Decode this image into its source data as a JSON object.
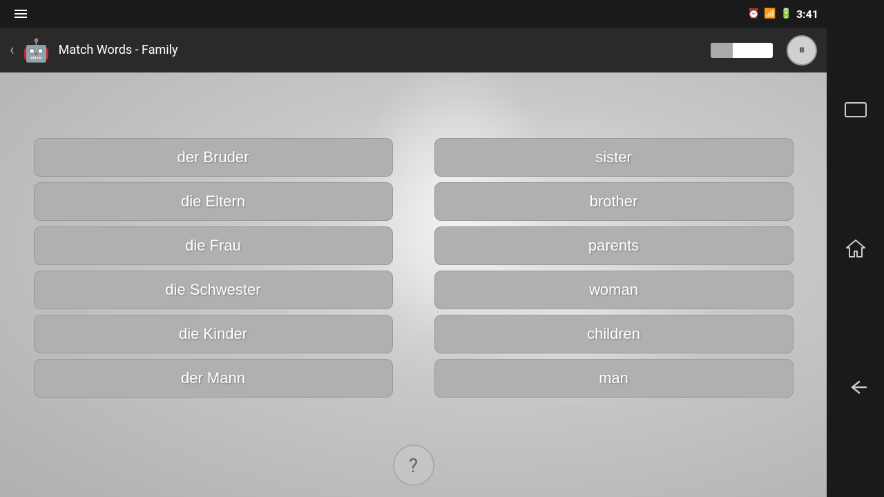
{
  "statusBar": {
    "time": "3:41",
    "icons": [
      "alarm",
      "signal",
      "battery"
    ]
  },
  "topBar": {
    "title": "Match Words - Family",
    "backLabel": "‹",
    "pauseIcon": "⏸",
    "progressPercent": 35
  },
  "leftColumn": {
    "items": [
      {
        "id": "der-bruder",
        "label": "der Bruder"
      },
      {
        "id": "die-eltern",
        "label": "die Eltern"
      },
      {
        "id": "die-frau",
        "label": "die Frau"
      },
      {
        "id": "die-schwester",
        "label": "die Schwester"
      },
      {
        "id": "die-kinder",
        "label": "die Kinder"
      },
      {
        "id": "der-mann",
        "label": "der Mann"
      }
    ]
  },
  "rightColumn": {
    "items": [
      {
        "id": "sister",
        "label": "sister"
      },
      {
        "id": "brother",
        "label": "brother"
      },
      {
        "id": "parents",
        "label": "parents"
      },
      {
        "id": "woman",
        "label": "woman"
      },
      {
        "id": "children",
        "label": "children"
      },
      {
        "id": "man",
        "label": "man"
      }
    ]
  },
  "helpBtn": {
    "label": "?"
  },
  "sideNav": {
    "icons": [
      "⬜",
      "⌂",
      "↩"
    ]
  },
  "hamburger": true
}
